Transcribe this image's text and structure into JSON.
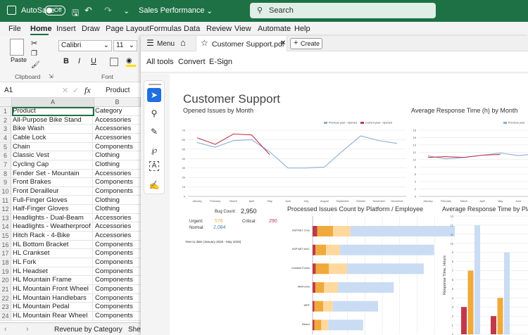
{
  "excel": {
    "autosave_label": "AutoSave",
    "autosave_state": "Off",
    "file_title": "Sales Performance",
    "search_placeholder": "Search",
    "menu": [
      "File",
      "Home",
      "Insert",
      "Draw",
      "Page Layout",
      "Formulas",
      "Data",
      "Review",
      "View",
      "Automate",
      "Help"
    ],
    "active_menu": "Home",
    "ribbon": {
      "paste": "Paste",
      "clipboard": "Clipboard",
      "font_name": "Calibri",
      "font_size": "11",
      "bold": "B",
      "italic": "I",
      "underline": "U",
      "font_group": "Font"
    },
    "name_box": "A1",
    "formula_value": "Product",
    "columns": [
      "A",
      "B"
    ],
    "rows": [
      {
        "n": "1",
        "a": "Product",
        "b": "Category"
      },
      {
        "n": "2",
        "a": "All-Purpose Bike Stand",
        "b": "Accessories"
      },
      {
        "n": "3",
        "a": "Bike Wash",
        "b": "Accessories"
      },
      {
        "n": "4",
        "a": "Cable Lock",
        "b": "Accessories"
      },
      {
        "n": "5",
        "a": "Chain",
        "b": "Components"
      },
      {
        "n": "6",
        "a": "Classic Vest",
        "b": "Clothing"
      },
      {
        "n": "7",
        "a": "Cycling Cap",
        "b": "Clothing"
      },
      {
        "n": "8",
        "a": "Fender Set - Mountain",
        "b": "Accessories"
      },
      {
        "n": "9",
        "a": "Front Brakes",
        "b": "Components"
      },
      {
        "n": "10",
        "a": "Front Derailleur",
        "b": "Components"
      },
      {
        "n": "11",
        "a": "Full-Finger Gloves",
        "b": "Clothing"
      },
      {
        "n": "12",
        "a": "Half-Finger Gloves",
        "b": "Clothing"
      },
      {
        "n": "13",
        "a": "Headlights - Dual-Beam",
        "b": "Accessories"
      },
      {
        "n": "14",
        "a": "Headlights - Weatherproof",
        "b": "Accessories"
      },
      {
        "n": "15",
        "a": "Hitch Rack - 4-Bike",
        "b": "Accessories"
      },
      {
        "n": "16",
        "a": "HL Bottom Bracket",
        "b": "Components"
      },
      {
        "n": "17",
        "a": "HL Crankset",
        "b": "Components"
      },
      {
        "n": "18",
        "a": "HL Fork",
        "b": "Components"
      },
      {
        "n": "19",
        "a": "HL Headset",
        "b": "Components"
      },
      {
        "n": "20",
        "a": "HL Mountain Frame",
        "b": "Components"
      },
      {
        "n": "21",
        "a": "HL Mountain Front Wheel",
        "b": "Components"
      },
      {
        "n": "22",
        "a": "HL Mountain Handlebars",
        "b": "Components"
      },
      {
        "n": "23",
        "a": "HL Mountain Pedal",
        "b": "Components"
      },
      {
        "n": "24",
        "a": "HL Mountain Rear Wheel",
        "b": "Components"
      }
    ],
    "sheet_tabs": [
      "Revenue by Category",
      "Shee"
    ]
  },
  "pdf": {
    "menu_label": "Menu",
    "tab_title": "Customer Support.pdf",
    "create_label": "Create",
    "tools": [
      "All tools",
      "Convert",
      "E-Sign"
    ],
    "doc_title": "Customer Support",
    "opened_title": "Opened Issues by Month",
    "response_title": "Average Response Time (h) by Month",
    "processed_title": "Processed Issues Count by Platform / Employee",
    "avg_platform_title": "Average Response Time by Platfo",
    "bug_count_label": "Bug Count:",
    "bug_count": "2,950",
    "urgent_label": "Urgent:",
    "urgent": "576",
    "critical_label": "Critical:",
    "critical": "290",
    "normal_label": "Normal:",
    "normal": "2,084",
    "ytd_label": "Year to date (January 2026 - May 2026)"
  },
  "chart_data": [
    {
      "type": "line",
      "title": "Opened Issues by Month",
      "categories": [
        "January",
        "February",
        "March",
        "April",
        "May",
        "June",
        "July",
        "August",
        "September",
        "October",
        "November",
        "December"
      ],
      "legend": [
        "Previous year - Opened",
        "Current year - Opened"
      ],
      "series": [
        {
          "name": "Previous year - Opened",
          "color": "#8aaed6",
          "values": [
            57,
            52,
            59,
            60,
            47,
            30,
            30,
            31,
            48,
            64,
            59,
            56
          ]
        },
        {
          "name": "Current year - Opened",
          "color": "#c0394b",
          "values": [
            62,
            55,
            66,
            65,
            44
          ]
        }
      ],
      "ylim": [
        0,
        70
      ],
      "yticks": [
        0,
        10,
        20,
        30,
        40,
        50,
        60,
        70
      ],
      "grid": true,
      "legend_placement": "top-right"
    },
    {
      "type": "line",
      "title": "Average Response Time (h) by Month",
      "categories": [
        "January",
        "February",
        "March",
        "April",
        "May",
        "June",
        "July"
      ],
      "legend": [
        "Previous year"
      ],
      "series": [
        {
          "name": "Previous year",
          "color": "#8aaed6",
          "values": [
            11,
            10.2,
            10.6,
            11.2,
            11.8,
            11.1,
            11.6
          ]
        },
        {
          "name": "Current year",
          "color": "#c0394b",
          "values": [
            10.6,
            10.8,
            10.6,
            11.2,
            11.4
          ]
        }
      ],
      "ylim": [
        0,
        18
      ],
      "yticks": [
        0,
        2,
        4,
        6,
        8,
        10,
        12,
        14,
        16,
        18
      ],
      "grid": true
    },
    {
      "type": "bar",
      "title": "Processed Issues Count by Platform / Employee",
      "categories": [
        "ASP.NET Core",
        "ASP.NET MVC",
        "Xamarin.Forms",
        "WinForms",
        "WPF",
        "Blazor"
      ],
      "series": [
        {
          "name": "s1",
          "color": "#c0394b",
          "values": [
            27,
            17,
            18,
            16,
            11,
            10
          ]
        },
        {
          "name": "s2",
          "color": "#f0a93b",
          "values": [
            90,
            60,
            75,
            50,
            50,
            40
          ]
        },
        {
          "name": "s3",
          "color": "#ffd89e",
          "values": [
            100,
            80,
            105,
            80,
            55,
            40
          ]
        },
        {
          "name": "s4",
          "color": "#c9dcf3",
          "values": [
            600,
            540,
            440,
            320,
            260,
            200
          ]
        }
      ],
      "xlim": [
        0,
        800
      ],
      "xticks": [
        0,
        100,
        200,
        300,
        400,
        500,
        600,
        700,
        800
      ],
      "grid": true
    },
    {
      "type": "bar",
      "title": "Average Response Time by Platfo",
      "categories": [
        "Xamarin.Forms",
        "WPF"
      ],
      "ylabel": "Response Time, Hours",
      "series": [
        {
          "name": "s1",
          "color": "#c0394b",
          "values": [
            3,
            2
          ]
        },
        {
          "name": "s2",
          "color": "#f0a93b",
          "values": [
            7,
            4
          ]
        },
        {
          "name": "s3",
          "color": "#c9dcf3",
          "values": [
            12,
            9
          ]
        }
      ],
      "ylim": [
        0,
        13
      ],
      "yticks": [
        0,
        1,
        2,
        3,
        4,
        5,
        6,
        7,
        8,
        9,
        10,
        11,
        12,
        13
      ],
      "grid": true
    }
  ]
}
